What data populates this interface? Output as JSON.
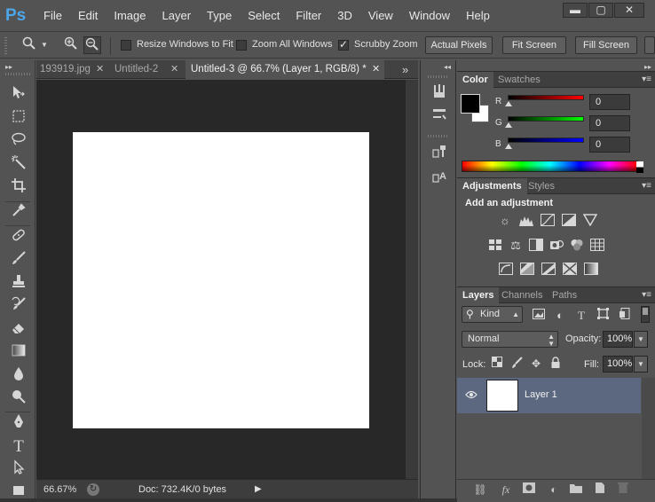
{
  "app": {
    "logo": "Ps",
    "menus": [
      "File",
      "Edit",
      "Image",
      "Layer",
      "Type",
      "Select",
      "Filter",
      "3D",
      "View",
      "Window",
      "Help"
    ],
    "window_controls": [
      "minimize",
      "maximize",
      "close"
    ]
  },
  "options": {
    "resize_windows_label": "Resize Windows to Fit",
    "resize_windows_checked": false,
    "zoom_all_label": "Zoom All Windows",
    "zoom_all_checked": false,
    "scrubby_label": "Scrubby Zoom",
    "scrubby_checked": true,
    "actual_pixels_label": "Actual Pixels",
    "fit_screen_label": "Fit Screen",
    "fill_screen_label": "Fill Screen"
  },
  "tools": [
    "move-tool",
    "marquee-tool",
    "lasso-tool",
    "magic-wand-tool",
    "crop-tool",
    "eyedropper-tool",
    "healing-brush-tool",
    "brush-tool",
    "clone-stamp-tool",
    "history-brush-tool",
    "eraser-tool",
    "gradient-tool",
    "blur-tool",
    "dodge-tool",
    "pen-tool",
    "type-tool",
    "path-selection-tool",
    "rectangle-tool"
  ],
  "documents": {
    "tabs": [
      {
        "label": "193919.jpg",
        "active": false
      },
      {
        "label": "Untitled-2",
        "active": false
      },
      {
        "label": "Untitled-3 @ 66.7% (Layer 1, RGB/8) *",
        "active": true
      }
    ],
    "more": "»"
  },
  "status": {
    "zoom": "66.67%",
    "doc_size": "Doc: 732.4K/0 bytes"
  },
  "color_panel": {
    "tabs": [
      "Color",
      "Swatches"
    ],
    "foreground": "#000000",
    "background": "#ffffff",
    "channels": [
      {
        "label": "R",
        "value": "0",
        "gradient_end": "#ff0000"
      },
      {
        "label": "G",
        "value": "0",
        "gradient_end": "#00ff00"
      },
      {
        "label": "B",
        "value": "0",
        "gradient_end": "#0000ff"
      }
    ]
  },
  "adjustments_panel": {
    "tabs": [
      "Adjustments",
      "Styles"
    ],
    "title": "Add an adjustment",
    "row1": [
      "brightness-contrast-icon",
      "levels-icon",
      "curves-icon",
      "exposure-icon",
      "vibrance-icon"
    ],
    "row2": [
      "hue-saturation-icon",
      "color-balance-icon",
      "black-white-icon",
      "photo-filter-icon",
      "channel-mixer-icon",
      "color-lookup-icon"
    ],
    "row3": [
      "invert-icon",
      "posterize-icon",
      "threshold-icon",
      "selective-color-icon",
      "gradient-map-icon"
    ]
  },
  "layers_panel": {
    "tabs": [
      "Layers",
      "Channels",
      "Paths"
    ],
    "filter_kind": "Kind",
    "blend_mode": "Normal",
    "opacity_label": "Opacity:",
    "opacity": "100%",
    "lock_label": "Lock:",
    "fill_label": "Fill:",
    "fill": "100%",
    "layers": [
      {
        "name": "Layer 1",
        "visible": true,
        "selected": true
      }
    ]
  },
  "colors": {
    "selection": "#5b6880",
    "canvas": "#ffffff",
    "pasteboard": "#282828"
  }
}
